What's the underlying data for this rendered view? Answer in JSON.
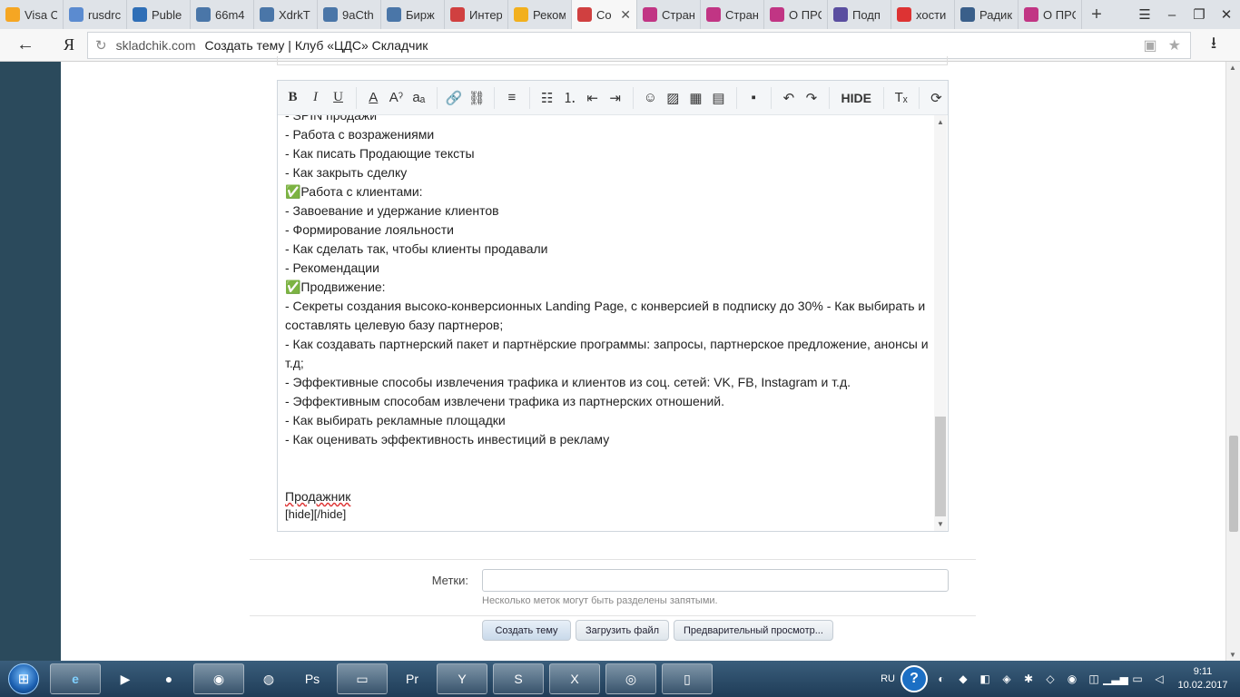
{
  "tabs": [
    {
      "title": "Visa C",
      "icon": "search-icon",
      "color": "#f5a623"
    },
    {
      "title": "rusdrc",
      "icon": "download-icon",
      "color": "#5b8bd0"
    },
    {
      "title": "Puble",
      "icon": "p-logo-icon",
      "color": "#2f6fb7"
    },
    {
      "title": "66m4",
      "icon": "vk-logo-icon",
      "color": "#4a76a8"
    },
    {
      "title": "XdrkT",
      "icon": "vk-logo-icon",
      "color": "#4a76a8"
    },
    {
      "title": "9aCth",
      "icon": "vk-logo-icon",
      "color": "#4a76a8"
    },
    {
      "title": "Бирж",
      "icon": "vk-logo-icon",
      "color": "#4a76a8"
    },
    {
      "title": "Интер",
      "icon": "chrome-icon",
      "color": "#d04040"
    },
    {
      "title": "Реком",
      "icon": "photos-icon",
      "color": "#f2b01e"
    },
    {
      "title": "Со",
      "icon": "chrome-icon",
      "color": "#d04040",
      "active": true
    },
    {
      "title": "Стран",
      "icon": "instagram-icon",
      "color": "#c13584"
    },
    {
      "title": "Стран",
      "icon": "instagram-icon",
      "color": "#c13584"
    },
    {
      "title": "О ПРС",
      "icon": "instagram-icon",
      "color": "#c13584"
    },
    {
      "title": "Подп",
      "icon": "list-icon",
      "color": "#5a4ea0"
    },
    {
      "title": "хости",
      "icon": "yandex-icon",
      "color": "#d33"
    },
    {
      "title": "Радик",
      "icon": "r-logo-icon",
      "color": "#3a5f8a"
    },
    {
      "title": "О ПРС",
      "icon": "instagram-icon",
      "color": "#c13584"
    }
  ],
  "address": {
    "host": "skladchik.com",
    "title": "Создать тему | Клуб «ЦДС» Складчик"
  },
  "editor": {
    "toolbar": {
      "hide_label": "HIDE"
    },
    "lines": [
      "- SPIN продажи",
      "- Работа с возражениями",
      "- Как писать Продающие тексты",
      "- Как закрыть сделку",
      "✅Работа с клиентами:",
      "- Завоевание и удержание клиентов",
      "- Формирование лояльности",
      "- Как сделать так, чтобы клиенты продавали",
      "- Рекомендации",
      "✅Продвижение:",
      "- Секреты создания высоко-конверсионных Landing Page, с конверсией в подписку до 30% - Как выбирать и составлять целевую базу партнеров;",
      "- Как создавать партнерский пакет и партнёрские программы: запросы, партнерское предложение, анонсы и т.д;",
      "- Эффективные способы извлечения трафика и клиентов из соц. сетей: VK, FB, Instagram и т.д.",
      "- Эффективным способам извлечени трафика из партнерских отношений.",
      "- Как выбирать рекламные площадки",
      "- Как оценивать эффективность инвестиций в рекламу"
    ],
    "signature": "Продажник",
    "hide_tag": "[hide][/hide]"
  },
  "tags": {
    "label": "Метки:",
    "value": "",
    "hint": "Несколько меток могут быть разделены запятыми."
  },
  "buttons": {
    "create": "Создать тему",
    "upload": "Загрузить файл",
    "preview": "Предварительный просмотр..."
  },
  "tray": {
    "lang": "RU",
    "time": "9:11",
    "date": "10.02.2017"
  }
}
